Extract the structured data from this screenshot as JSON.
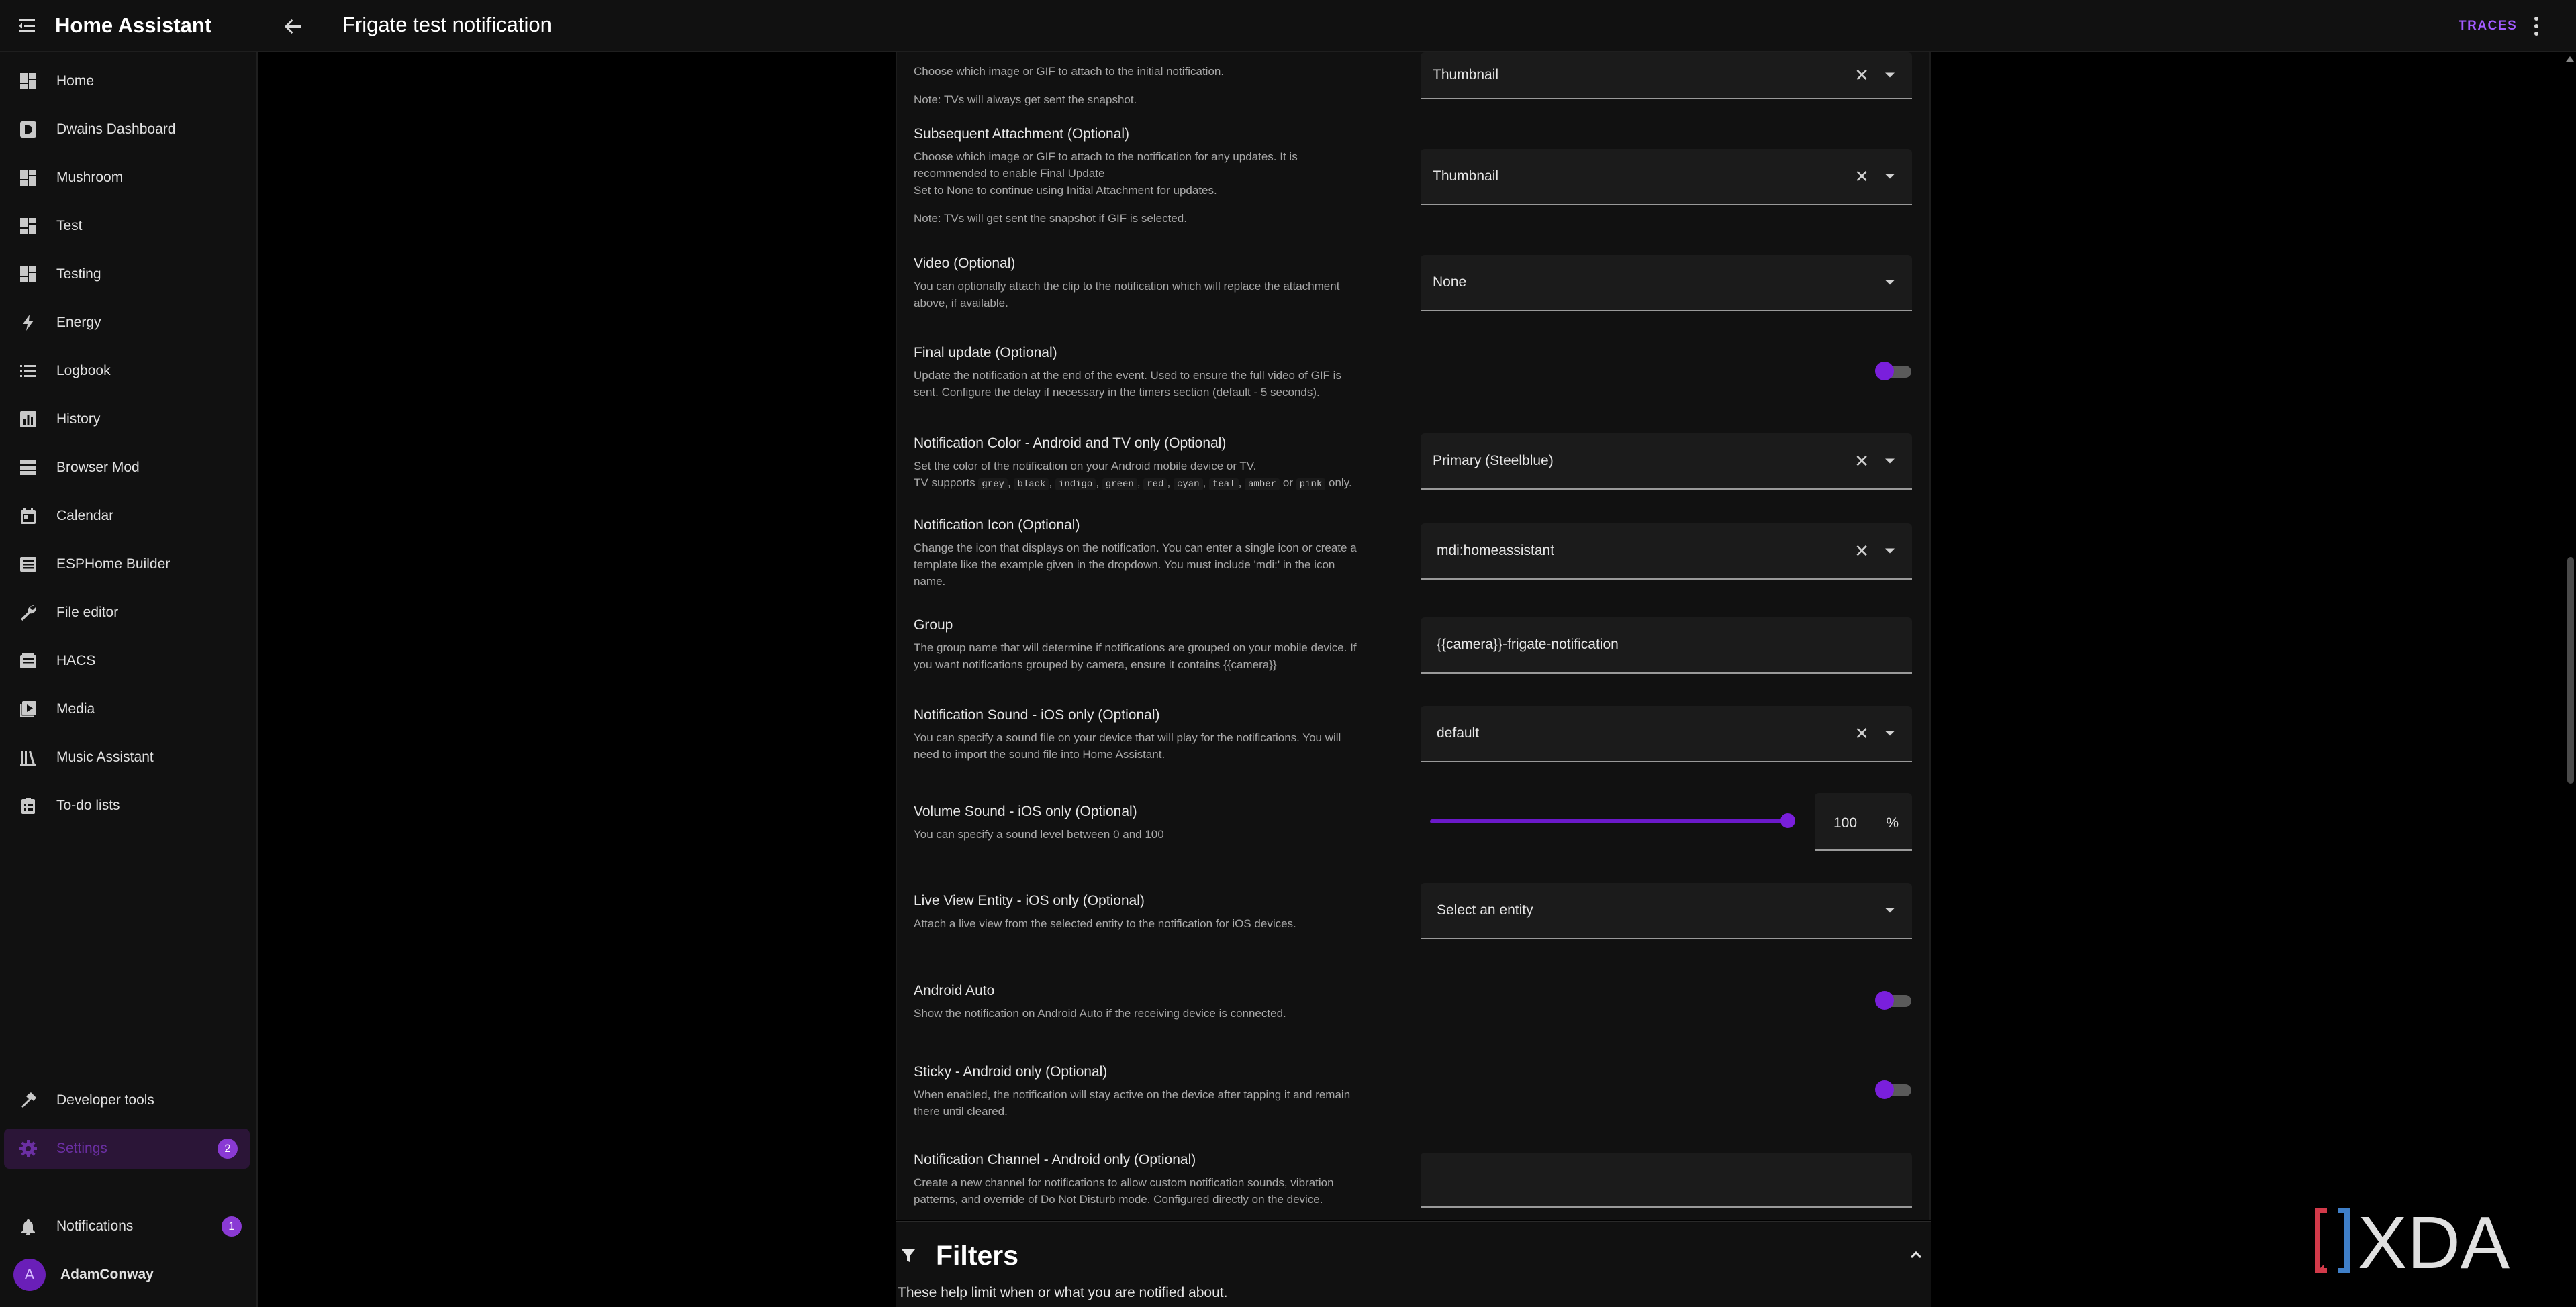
{
  "topbar": {
    "brand": "Home Assistant",
    "title": "Frigate test notification",
    "traces_label": "TRACES"
  },
  "sidebar": {
    "items": [
      {
        "label": "Home",
        "icon": "dashboard-icon"
      },
      {
        "label": "Dwains Dashboard",
        "icon": "dwains-icon"
      },
      {
        "label": "Mushroom",
        "icon": "dashboard-icon"
      },
      {
        "label": "Test",
        "icon": "dashboard-icon"
      },
      {
        "label": "Testing",
        "icon": "dashboard-icon"
      },
      {
        "label": "Energy",
        "icon": "lightning-icon"
      },
      {
        "label": "Logbook",
        "icon": "list-icon"
      },
      {
        "label": "History",
        "icon": "chart-icon"
      },
      {
        "label": "Browser Mod",
        "icon": "server-icon"
      },
      {
        "label": "Calendar",
        "icon": "calendar-icon"
      },
      {
        "label": "ESPHome Builder",
        "icon": "esphome-icon"
      },
      {
        "label": "File editor",
        "icon": "wrench-icon"
      },
      {
        "label": "HACS",
        "icon": "hacs-icon"
      },
      {
        "label": "Media",
        "icon": "media-icon"
      },
      {
        "label": "Music Assistant",
        "icon": "library-icon"
      },
      {
        "label": "To-do lists",
        "icon": "clipboard-icon"
      }
    ],
    "developer_tools": "Developer tools",
    "settings": {
      "label": "Settings",
      "badge": "2"
    },
    "notifications": {
      "label": "Notifications",
      "badge": "1"
    },
    "user": {
      "name": "AdamConway",
      "initial": "A"
    }
  },
  "form": {
    "initial_attachment": {
      "desc": "Choose which image or GIF to attach to the initial notification.",
      "note": "Note: TVs will always get sent the snapshot.",
      "value": "Thumbnail"
    },
    "subsequent_attachment": {
      "title": "Subsequent Attachment (Optional)",
      "desc1": "Choose which image or GIF to attach to the notification for any updates. It is",
      "desc2": "recommended to enable Final Update",
      "desc3": "Set to None to continue using Initial Attachment for updates.",
      "note": "Note: TVs will get sent the snapshot if GIF is selected.",
      "value": "Thumbnail"
    },
    "video": {
      "title": "Video (Optional)",
      "desc1": "You can optionally attach the clip to the notification which will replace the attachment",
      "desc2": "above, if available.",
      "value": "None"
    },
    "final_update": {
      "title": "Final update (Optional)",
      "desc1": "Update the notification at the end of the event. Used to ensure the full video of GIF is",
      "desc2": "sent. Configure the delay if necessary in the timers section (default - 5 seconds).",
      "enabled": false
    },
    "notification_color": {
      "title": "Notification Color - Android and TV only (Optional)",
      "desc1": "Set the color of the notification on your Android mobile device or TV.",
      "tv_supports": "TV supports",
      "colors": [
        "grey",
        "black",
        "indigo",
        "green",
        "red",
        "cyan",
        "teal",
        "amber"
      ],
      "or": "or",
      "last_color": "pink",
      "only": "only.",
      "value": "Primary (Steelblue)"
    },
    "notification_icon": {
      "title": "Notification Icon (Optional)",
      "desc1": "Change the icon that displays on the notification. You can enter a single icon or create a",
      "desc2": "template like the example given in the dropdown. You must include 'mdi:' in the icon",
      "desc3": "name.",
      "value": "mdi:homeassistant"
    },
    "group": {
      "title": "Group",
      "desc1": "The group name that will determine if notifications are grouped on your mobile device. If",
      "desc2": "you want notifications grouped by camera, ensure it contains {{camera}}",
      "value": "{{camera}}-frigate-notification"
    },
    "notification_sound": {
      "title": "Notification Sound - iOS only (Optional)",
      "desc1": "You can specify a sound file on your device that will play for the notifications. You will",
      "desc2": "need to import the sound file into Home Assistant.",
      "value": "default"
    },
    "volume_sound": {
      "title": "Volume Sound - iOS only (Optional)",
      "desc": "You can specify a sound level between 0 and 100",
      "value": "100",
      "unit": "%",
      "level_percent": 100
    },
    "live_view": {
      "title": "Live View Entity - iOS only (Optional)",
      "desc": "Attach a live view from the selected entity to the notification for iOS devices.",
      "placeholder": "Select an entity"
    },
    "android_auto": {
      "title": "Android Auto",
      "desc": "Show the notification on Android Auto if the receiving device is connected.",
      "enabled": false
    },
    "sticky": {
      "title": "Sticky - Android only (Optional)",
      "desc1": "When enabled, the notification will stay active on the device after tapping it and remain",
      "desc2": "there until cleared.",
      "enabled": false
    },
    "channel": {
      "title": "Notification Channel - Android only (Optional)",
      "desc1": "Create a new channel for notifications to allow custom notification sounds, vibration",
      "desc2": "patterns, and override of Do Not Disturb mode. Configured directly on the device.",
      "value": ""
    }
  },
  "filters": {
    "title": "Filters",
    "desc": "These help limit when or what you are notified about."
  },
  "watermark": "XDA",
  "colors": {
    "accent": "#7a1fdc",
    "background": "#000000",
    "surface": "#111111",
    "field": "#1b1b1b"
  }
}
